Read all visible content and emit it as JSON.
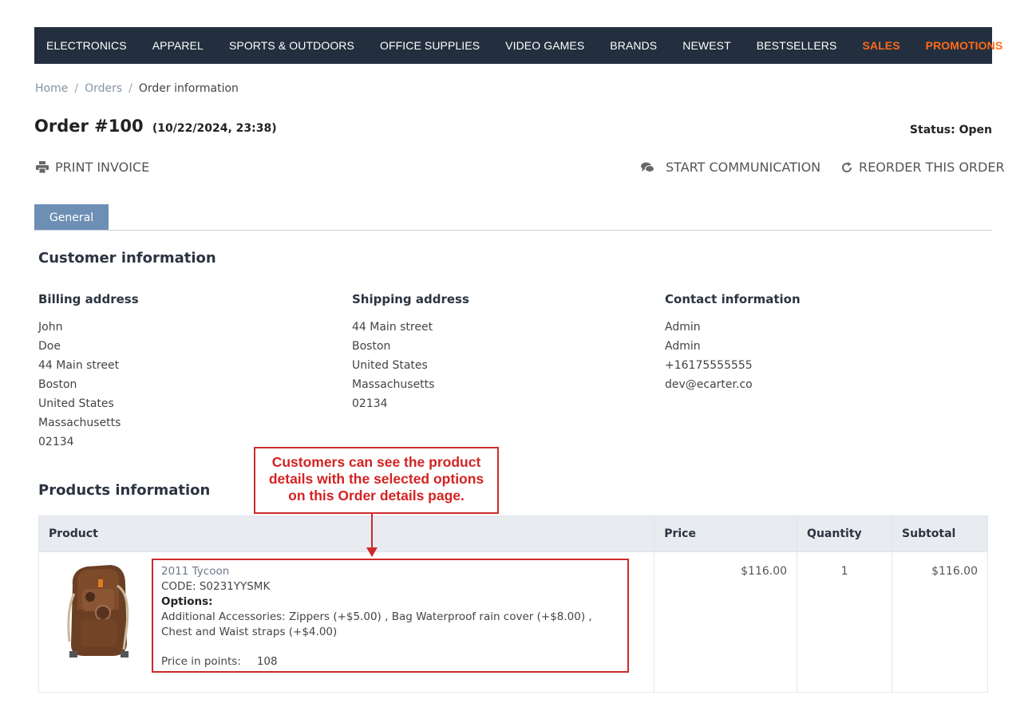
{
  "nav": {
    "items": [
      "ELECTRONICS",
      "APPAREL",
      "SPORTS & OUTDOORS",
      "OFFICE SUPPLIES",
      "VIDEO GAMES",
      "BRANDS",
      "NEWEST",
      "BESTSELLERS"
    ],
    "hot_items": [
      "SALES",
      "PROMOTIONS"
    ],
    "bg_color": "#232f3e",
    "hot_color": "#ff6a1a"
  },
  "breadcrumb": {
    "home": "Home",
    "orders": "Orders",
    "current": "Order information"
  },
  "order": {
    "title": "Order #100",
    "date": "(10/22/2024, 23:38)",
    "status": "Status: Open"
  },
  "actions": {
    "print": "PRINT INVOICE",
    "communicate": "START COMMUNICATION",
    "reorder": "REORDER THIS ORDER"
  },
  "tabs": {
    "general": "General"
  },
  "customer": {
    "heading": "Customer information",
    "billing": {
      "title": "Billing address",
      "lines": [
        "John",
        "Doe",
        "44 Main street",
        "Boston",
        "United States",
        "Massachusetts",
        "02134"
      ]
    },
    "shipping": {
      "title": "Shipping address",
      "lines": [
        "44 Main street",
        "Boston",
        "United States",
        "Massachusetts",
        "02134"
      ]
    },
    "contact": {
      "title": "Contact information",
      "lines": [
        "Admin",
        "Admin",
        "+16175555555",
        "dev@ecarter.co"
      ]
    }
  },
  "products": {
    "heading": "Products information",
    "columns": {
      "product": "Product",
      "price": "Price",
      "quantity": "Quantity",
      "subtotal": "Subtotal"
    },
    "items": [
      {
        "name": "2011 Tycoon",
        "code": "CODE: S0231YYSMK",
        "options_label": "Options:",
        "options_text": "Additional Accessories:  Zippers (+$5.00) , Bag Waterproof rain cover (+$8.00) , Chest and Waist straps (+$4.00)",
        "points_label": "Price in points:",
        "points_value": "108",
        "price": "$116.00",
        "quantity": "1",
        "subtotal": "$116.00"
      }
    ]
  },
  "annotation": {
    "line1": "Customers can see the product",
    "line2": "details with the selected options",
    "line3": "on this Order details page.",
    "color": "#cc2b2b"
  }
}
